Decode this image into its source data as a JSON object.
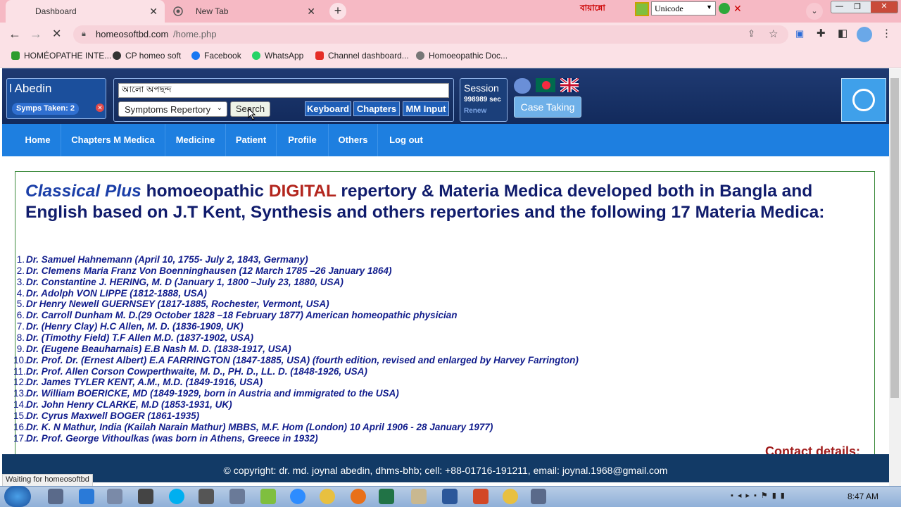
{
  "browser": {
    "tabs": [
      {
        "label": "Dashboard"
      },
      {
        "label": "New Tab"
      }
    ],
    "url_host": "homeosoftbd.com",
    "url_path": "/home.php",
    "ext_text": "বায়ান্নো",
    "unicode_select": "Unicode",
    "bookmarks": [
      "HOMÉOPATHE INTE...",
      "CP homeo soft",
      "Facebook",
      "WhatsApp",
      "Channel dashboard...",
      "Homoeopathic Doc..."
    ],
    "status_text": "Waiting for homeosoftbd"
  },
  "header": {
    "user_name": "l Abedin",
    "symps_taken": "Symps Taken: 2",
    "search_value": "আলো অপছন্দ",
    "repertory_select": "Symptoms Repertory",
    "search_button": "Search",
    "keyboard_button": "Keyboard",
    "chapters_button": "Chapters",
    "mm_input_button": "MM Input",
    "session_label": "Session",
    "session_seconds": "998989 sec",
    "renew_label": "Renew",
    "case_taking_button": "Case Taking"
  },
  "nav": [
    "Home",
    "Chapters M Medica",
    "Medicine",
    "Patient",
    "Profile",
    "Others",
    "Log out"
  ],
  "intro": {
    "brand": "Classical Plus",
    "part1": " homoeopathic ",
    "digital": "DIGITAL",
    "part2": " repertory & Materia Medica developed both in Bangla and English based on J.T Kent, Synthesis and others repertories and the following 17 Materia Medica:"
  },
  "materia_medica": [
    "Dr. Samuel Hahnemann (April 10, 1755- July 2, 1843, Germany)",
    "Dr. Clemens Maria Franz Von Boenninghausen  (12 March 1785 –26 January 1864)",
    "Dr. Constantine J. HERING, M. D (January 1, 1800 –July 23, 1880, USA)",
    "Dr. Adolph VON LIPPE (1812-1888, USA)",
    "Dr Henry Newell GUERNSEY (1817-1885, Rochester, Vermont, USA)",
    "Dr. Carroll Dunham M. D.(29 October 1828 –18 February 1877) American homeopathic physician",
    "Dr. (Henry Clay) H.C Allen, M. D. (1836-1909, UK)",
    "Dr. (Timothy Field) T.F Allen M.D. (1837-1902, USA)",
    "Dr. (Eugene Beauharnais) E.B Nash M. D. (1838-1917, USA)",
    "Dr. Prof. Dr. (Ernest Albert) E.A FARRINGTON (1847-1885, USA) (fourth edition, revised and enlarged by Harvey Farrington)",
    "Dr. Prof. Allen Corson Cowperthwaite, M. D., PH. D., LL. D. (1848-1926, USA)",
    "Dr. James TYLER KENT, A.M., M.D.  (1849-1916, USA)",
    "Dr. William BOERICKE, MD (1849-1929, born in Austria and immigrated to the USA)",
    "Dr. John Henry CLARKE, M.D (1853-1931, UK)",
    "Dr. Cyrus Maxwell BOGER (1861-1935)",
    "Dr. K. N Mathur, India (Kailah Narain Mathur) MBBS, M.F. Hom (London) 10 April 1906 - 28 January 1977)",
    "Dr. Prof. George Vithoulkas (was born in Athens, Greece in 1932)"
  ],
  "contact_heading": "Contact details:",
  "footer_text": "© copyright: dr. md. joynal abedin, dhms-bhb; cell: +88-01716-191211, email: joynal.1968@gmail.com",
  "taskbar": {
    "clock": "8:47 AM"
  },
  "colors": {
    "nav": "#1e7fe0",
    "header": "#1f3a72",
    "digital_red": "#b3261e",
    "text_navy": "#101c8c"
  }
}
